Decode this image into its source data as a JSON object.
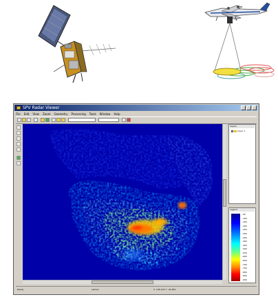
{
  "window": {
    "title": "SPV Radar Viewer",
    "menus": [
      "File",
      "Edit",
      "View",
      "Zoom",
      "Geometry",
      "Processing",
      "Tools",
      "Window",
      "Help"
    ]
  },
  "layers_panel": {
    "title": "Layers",
    "items": [
      {
        "label": "Layer 1",
        "checked": true
      }
    ]
  },
  "legend": {
    "title": "Legend",
    "ticks": [
      "-50",
      "-100",
      "-150",
      "-200",
      "-250",
      "-300",
      "-350",
      "-400",
      "-450",
      "-500",
      "-550",
      "-600",
      "-650",
      "-700",
      "-750",
      "-800",
      "-850",
      "-900"
    ]
  },
  "status": {
    "left": "Ready",
    "middle": "Lat/Lon",
    "right": "X: 146.123 Y: -41.852"
  },
  "colors": {
    "titlebar": "#0a246a",
    "map_background": "#0000a8",
    "flight_line_yellow": "#f0e040",
    "flight_line_red": "#e05050",
    "flight_line_green": "#40b040",
    "flight_line_teal": "#40a0a0"
  },
  "icons": [
    "satellite-icon",
    "aircraft-icon"
  ]
}
